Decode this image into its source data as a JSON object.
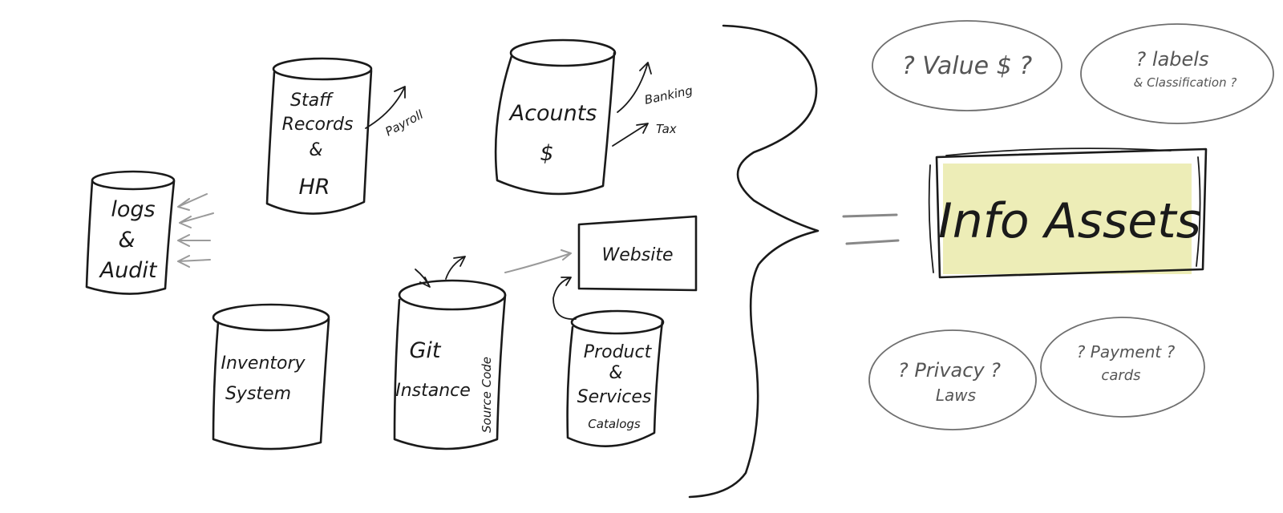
{
  "stores": {
    "logs_line1": "logs",
    "logs_line2": "&",
    "logs_line3": "Audit",
    "staff_line1": "Staff",
    "staff_line2": "Records",
    "staff_line3": "&",
    "staff_line4": "HR",
    "accounts_line1": "Acounts",
    "accounts_line2": "$",
    "inventory_line1": "Inventory",
    "inventory_line2": "System",
    "git_line1": "Git",
    "git_line2": "Instance",
    "git_side": "Source Code",
    "product_line1": "Product",
    "product_line2": "&",
    "product_line3": "Services",
    "product_line4": "Catalogs",
    "website": "Website"
  },
  "annotations": {
    "payroll": "Payroll",
    "banking": "Banking",
    "tax": "Tax"
  },
  "result": {
    "label": "Info Assets",
    "highlight_color": "#d8d860"
  },
  "questions": {
    "value": "? Value $ ?",
    "labels_line1": "? labels",
    "labels_line2": "& Classification ?",
    "privacy_line1": "? Privacy ?",
    "privacy_line2": "Laws",
    "payment_line1": "? Payment ?",
    "payment_line2": "cards"
  }
}
